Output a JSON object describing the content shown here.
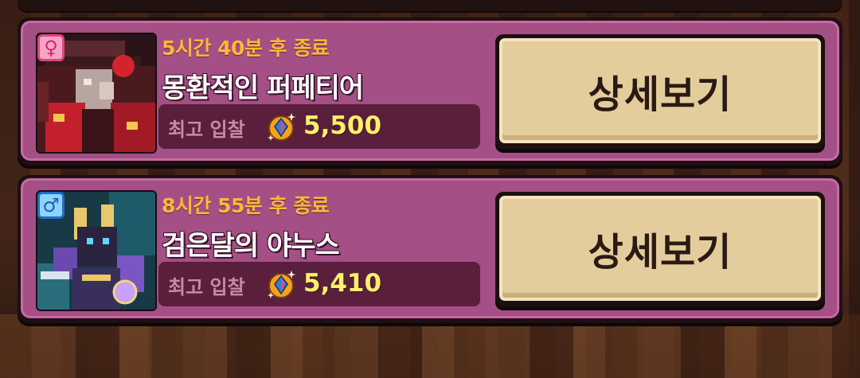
{
  "auctions": [
    {
      "gender": "female",
      "gender_symbol": "♀",
      "time_left": "5시간 40분 후 종료",
      "name": "몽환적인 퍼페티어",
      "bid_label": "최고 입찰",
      "bid_value": "5,500",
      "button_label": "상세보기"
    },
    {
      "gender": "male",
      "gender_symbol": "♂",
      "time_left": "8시간 55분 후 종료",
      "name": "검은달의 야누스",
      "bid_label": "최고 입찰",
      "bid_value": "5,410",
      "button_label": "상세보기"
    }
  ],
  "colors": {
    "card_bg": "#a44f86",
    "timer": "#ffb739",
    "bid_value": "#fff06a",
    "button": "#e3cd9c"
  },
  "icons": {
    "currency": "gem-coin-icon"
  }
}
